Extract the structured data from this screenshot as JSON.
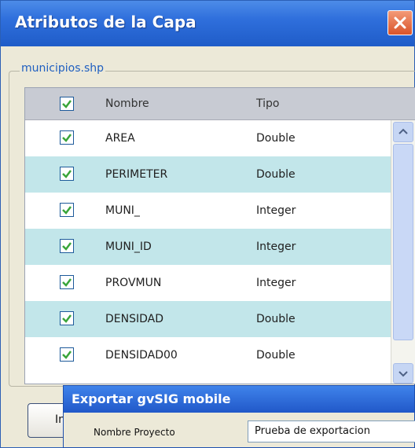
{
  "dialog": {
    "title": "Atributos de la Capa",
    "group_label": "municipios.shp"
  },
  "table": {
    "headers": {
      "name": "Nombre",
      "type": "Tipo"
    },
    "rows": [
      {
        "name": "AREA",
        "type": "Double",
        "checked": true
      },
      {
        "name": "PERIMETER",
        "type": "Double",
        "checked": true
      },
      {
        "name": "MUNI_",
        "type": "Integer",
        "checked": true
      },
      {
        "name": "MUNI_ID",
        "type": "Integer",
        "checked": true
      },
      {
        "name": "PROVMUN",
        "type": "Integer",
        "checked": true
      },
      {
        "name": "DENSIDAD",
        "type": "Double",
        "checked": true
      },
      {
        "name": "DENSIDAD00",
        "type": "Double",
        "checked": true
      }
    ]
  },
  "bottom_button": {
    "label": "In"
  },
  "export_dialog": {
    "title": "Exportar gvSIG mobile",
    "project_name_label": "Nombre Proyecto",
    "project_name_value": "Prueba de exportacion"
  },
  "colors": {
    "titlebar": "#2f6fdc",
    "row_alt": "#c2e6ea",
    "checkbox_check": "#3aa53a"
  }
}
